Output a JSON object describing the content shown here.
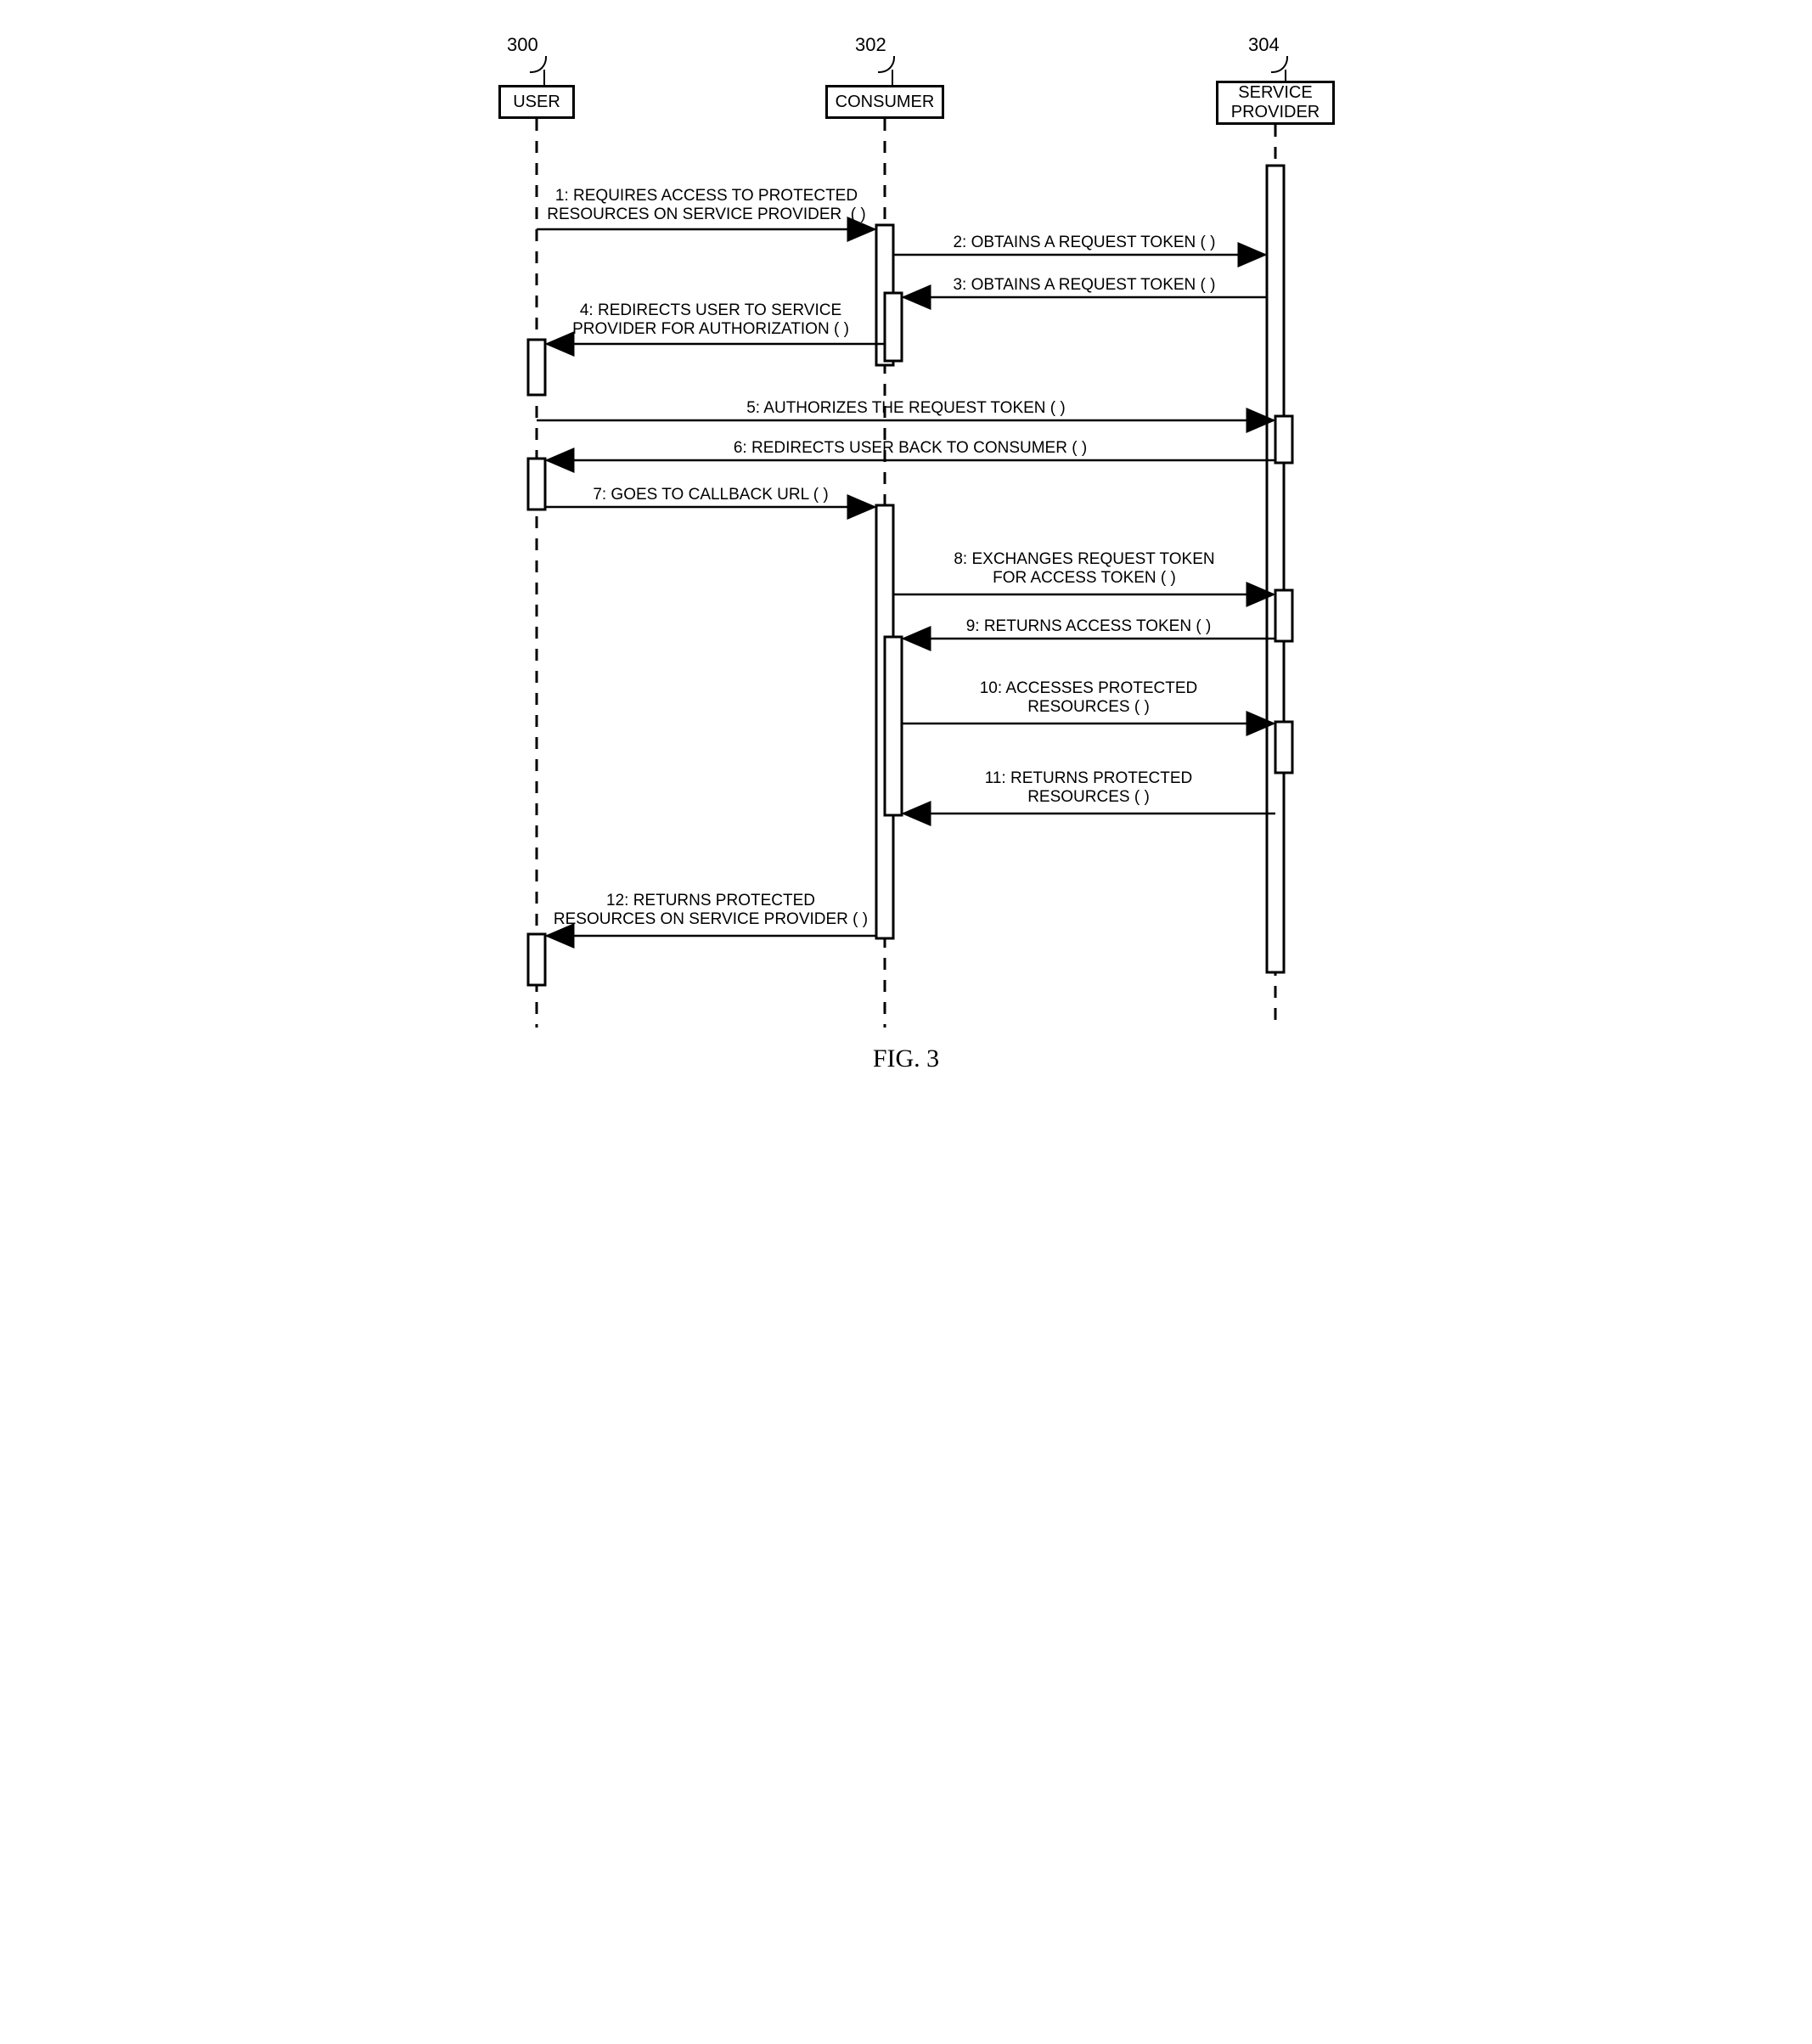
{
  "figure": {
    "caption": "FIG. 3"
  },
  "actors": {
    "user": {
      "ref": "300",
      "label": "USER"
    },
    "consumer": {
      "ref": "302",
      "label": "CONSUMER"
    },
    "provider": {
      "ref": "304",
      "label": "SERVICE\nPROVIDER"
    }
  },
  "messages": {
    "m1": "1: REQUIRES ACCESS TO PROTECTED\nRESOURCES ON SERVICE PROVIDER  ( )",
    "m2": "2: OBTAINS A REQUEST TOKEN ( )",
    "m3": "3: OBTAINS A REQUEST TOKEN ( )",
    "m4": "4: REDIRECTS USER TO SERVICE\nPROVIDER FOR AUTHORIZATION ( )",
    "m5": "5: AUTHORIZES THE REQUEST TOKEN ( )",
    "m6": "6: REDIRECTS USER BACK TO CONSUMER ( )",
    "m7": "7: GOES TO CALLBACK URL ( )",
    "m8": "8: EXCHANGES REQUEST TOKEN\nFOR ACCESS TOKEN ( )",
    "m9": "9: RETURNS ACCESS TOKEN ( )",
    "m10": "10: ACCESSES PROTECTED\nRESOURCES ( )",
    "m11": "11: RETURNS PROTECTED\nRESOURCES ( )",
    "m12": "12: RETURNS PROTECTED\nRESOURCES ON SERVICE PROVIDER ( )"
  },
  "chart_data": {
    "type": "sequence-diagram",
    "lifelines": [
      "USER",
      "CONSUMER",
      "SERVICE PROVIDER"
    ],
    "messages": [
      {
        "n": 1,
        "from": "USER",
        "to": "CONSUMER",
        "text": "REQUIRES ACCESS TO PROTECTED RESOURCES ON SERVICE PROVIDER ( )"
      },
      {
        "n": 2,
        "from": "CONSUMER",
        "to": "SERVICE PROVIDER",
        "text": "OBTAINS A REQUEST TOKEN ( )"
      },
      {
        "n": 3,
        "from": "SERVICE PROVIDER",
        "to": "CONSUMER",
        "text": "OBTAINS A REQUEST TOKEN ( )"
      },
      {
        "n": 4,
        "from": "CONSUMER",
        "to": "USER",
        "text": "REDIRECTS USER TO SERVICE PROVIDER FOR AUTHORIZATION ( )"
      },
      {
        "n": 5,
        "from": "USER",
        "to": "SERVICE PROVIDER",
        "text": "AUTHORIZES THE REQUEST TOKEN ( )"
      },
      {
        "n": 6,
        "from": "SERVICE PROVIDER",
        "to": "USER",
        "text": "REDIRECTS USER BACK TO CONSUMER ( )"
      },
      {
        "n": 7,
        "from": "USER",
        "to": "CONSUMER",
        "text": "GOES TO CALLBACK URL ( )"
      },
      {
        "n": 8,
        "from": "CONSUMER",
        "to": "SERVICE PROVIDER",
        "text": "EXCHANGES REQUEST TOKEN FOR ACCESS TOKEN ( )"
      },
      {
        "n": 9,
        "from": "SERVICE PROVIDER",
        "to": "CONSUMER",
        "text": "RETURNS ACCESS TOKEN ( )"
      },
      {
        "n": 10,
        "from": "CONSUMER",
        "to": "SERVICE PROVIDER",
        "text": "ACCESSES PROTECTED RESOURCES ( )"
      },
      {
        "n": 11,
        "from": "SERVICE PROVIDER",
        "to": "CONSUMER",
        "text": "RETURNS PROTECTED RESOURCES ( )"
      },
      {
        "n": 12,
        "from": "CONSUMER",
        "to": "USER",
        "text": "RETURNS PROTECTED RESOURCES ON SERVICE PROVIDER ( )"
      }
    ]
  }
}
